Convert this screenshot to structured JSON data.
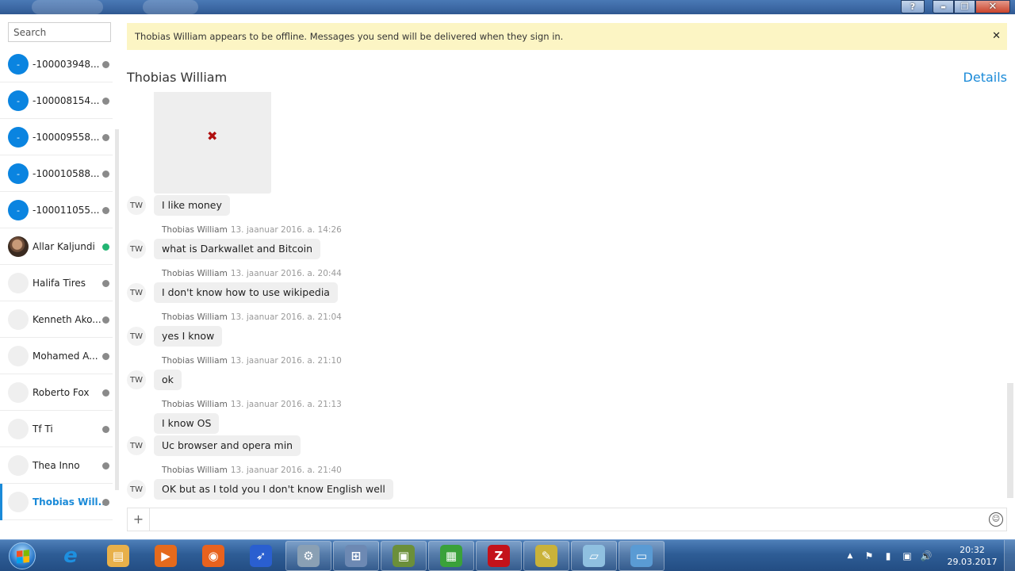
{
  "window": {
    "help_label": "?",
    "minimize_label": "▬",
    "maximize_label": "❐",
    "close_label": "✕"
  },
  "sidebar": {
    "search_placeholder": "Search",
    "contacts": [
      {
        "name": "-100003948...",
        "avatar": "-",
        "avatar_style": "blue",
        "status": "offline"
      },
      {
        "name": "-100008154...",
        "avatar": "-",
        "avatar_style": "blue",
        "status": "offline"
      },
      {
        "name": "-100009558...",
        "avatar": "-",
        "avatar_style": "blue",
        "status": "offline"
      },
      {
        "name": "-100010588...",
        "avatar": "-",
        "avatar_style": "blue",
        "status": "offline"
      },
      {
        "name": "-100011055...",
        "avatar": "-",
        "avatar_style": "blue",
        "status": "offline"
      },
      {
        "name": "Allar Kaljundi",
        "avatar": "",
        "avatar_style": "photo",
        "status": "online"
      },
      {
        "name": "Halifa Tires",
        "avatar": "",
        "avatar_style": "plain",
        "status": "offline"
      },
      {
        "name": "Kenneth Ako...",
        "avatar": "",
        "avatar_style": "plain",
        "status": "offline"
      },
      {
        "name": "Mohamed A...",
        "avatar": "",
        "avatar_style": "plain",
        "status": "offline"
      },
      {
        "name": "Roberto Fox",
        "avatar": "",
        "avatar_style": "plain",
        "status": "offline"
      },
      {
        "name": "Tf Ti",
        "avatar": "",
        "avatar_style": "plain",
        "status": "offline"
      },
      {
        "name": "Thea Inno",
        "avatar": "",
        "avatar_style": "plain",
        "status": "offline"
      },
      {
        "name": "Thobias Will...",
        "avatar": "",
        "avatar_style": "plain",
        "status": "offline",
        "active": true
      }
    ]
  },
  "banner": {
    "text": "Thobias William appears to be offline.  Messages you send will be delivered when they sign in.",
    "close_label": "✕"
  },
  "chat": {
    "title": "Thobias William",
    "details_label": "Details",
    "broken_image_glyph": "✖",
    "messages": [
      {
        "meta": null,
        "text": "I like money",
        "avatar": "TW"
      },
      {
        "meta": {
          "who": "Thobias William",
          "when": "13. jaanuar 2016. a. 14:26"
        },
        "text": "what is Darkwallet and Bitcoin",
        "avatar": "TW"
      },
      {
        "meta": {
          "who": "Thobias William",
          "when": "13. jaanuar 2016. a. 20:44"
        },
        "text": "I don't know how to use wikipedia",
        "avatar": "TW"
      },
      {
        "meta": {
          "who": "Thobias William",
          "when": "13. jaanuar 2016. a. 21:04"
        },
        "text": "yes I know",
        "avatar": "TW"
      },
      {
        "meta": {
          "who": "Thobias William",
          "when": "13. jaanuar 2016. a. 21:10"
        },
        "text": "ok",
        "avatar": "TW"
      },
      {
        "meta": {
          "who": "Thobias William",
          "when": "13. jaanuar 2016. a. 21:13"
        },
        "text": "I know OS",
        "avatar": ""
      },
      {
        "meta": null,
        "text": "Uc browser and opera min",
        "avatar": "TW"
      },
      {
        "meta": {
          "who": "Thobias William",
          "when": "13. jaanuar 2016. a. 21:40"
        },
        "text": "OK but as I told you I don't know English well",
        "avatar": "TW"
      }
    ]
  },
  "composer": {
    "plus_label": "+",
    "emoji_label": "☺",
    "placeholder": ""
  },
  "taskbar": {
    "tasks": [
      {
        "name": "ie-icon",
        "glyph": "e",
        "color": "#1e90e0",
        "open": false
      },
      {
        "name": "file-explorer-icon",
        "glyph": "▤",
        "color": "#e8b04a",
        "open": false
      },
      {
        "name": "media-player-icon",
        "glyph": "▶",
        "color": "#e56a1c",
        "open": false
      },
      {
        "name": "firefox-icon",
        "glyph": "◉",
        "color": "#e8621e",
        "open": false
      },
      {
        "name": "feather-app-icon",
        "glyph": "➶",
        "color": "#2a5fd0",
        "open": false
      },
      {
        "name": "network-app-icon",
        "glyph": "⚙",
        "color": "#8aa0b4",
        "open": true
      },
      {
        "name": "calculator-app-icon",
        "glyph": "⊞",
        "color": "#6d89b3",
        "open": true
      },
      {
        "name": "monitor-app-icon",
        "glyph": "▣",
        "color": "#6b8f3a",
        "open": true
      },
      {
        "name": "spreadsheet-app-icon",
        "glyph": "▦",
        "color": "#3aa13a",
        "open": true
      },
      {
        "name": "filezilla-icon",
        "glyph": "Z",
        "color": "#c4121a",
        "open": true
      },
      {
        "name": "chart-notes-icon",
        "glyph": "✎",
        "color": "#c9b23a",
        "open": true
      },
      {
        "name": "notepad-icon",
        "glyph": "▱",
        "color": "#8fc0e0",
        "open": true
      },
      {
        "name": "remote-desktop-icon",
        "glyph": "▭",
        "color": "#5a9bd4",
        "open": true
      }
    ],
    "tray": {
      "arrow": "▲",
      "icons": [
        "⚑",
        "▮",
        "▣",
        "🔊"
      ],
      "time": "20:32",
      "date": "29.03.2017"
    }
  }
}
